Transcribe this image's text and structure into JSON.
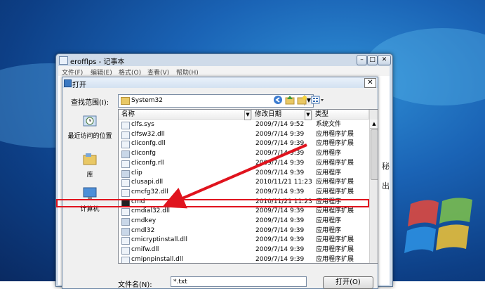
{
  "notepad": {
    "title": "erofflps - 记事本",
    "menu": [
      "文件(F)",
      "编辑(E)",
      "格式(O)",
      "查看(V)",
      "帮助(H)"
    ],
    "caption_buttons": [
      "–",
      "□",
      "✕"
    ],
    "edge_chars": [
      "秘",
      "出"
    ]
  },
  "dialog": {
    "title": "打开",
    "close_glyph": "✕",
    "lookin_label": "查找范围(I):",
    "lookin_value": "System32",
    "toolbar_icons": [
      "back-icon",
      "up-folder-icon",
      "new-folder-icon",
      "view-menu-icon"
    ],
    "places": [
      {
        "label": "最近访问的位置",
        "icon": "recent-places-icon"
      },
      {
        "label": "库",
        "icon": "libraries-icon"
      },
      {
        "label": "计算机",
        "icon": "computer-icon"
      }
    ],
    "columns": [
      "名称",
      "修改日期",
      "类型"
    ],
    "files": [
      {
        "name": "clfs.sys",
        "date": "2009/7/14 9:52",
        "type": "系统文件",
        "icon": "sys"
      },
      {
        "name": "clfsw32.dll",
        "date": "2009/7/14 9:39",
        "type": "应用程序扩展",
        "icon": "dll"
      },
      {
        "name": "cliconfg.dll",
        "date": "2009/7/14 9:39",
        "type": "应用程序扩展",
        "icon": "dll"
      },
      {
        "name": "cliconfg",
        "date": "2009/7/14 9:39",
        "type": "应用程序",
        "icon": "cpl"
      },
      {
        "name": "cliconfg.rll",
        "date": "2009/7/14 9:39",
        "type": "应用程序扩展",
        "icon": "dll"
      },
      {
        "name": "clip",
        "date": "2009/7/14 9:39",
        "type": "应用程序",
        "icon": "cpl"
      },
      {
        "name": "clusapi.dll",
        "date": "2010/11/21 11:23",
        "type": "应用程序扩展",
        "icon": "dll"
      },
      {
        "name": "cmcfg32.dll",
        "date": "2009/7/14 9:39",
        "type": "应用程序扩展",
        "icon": "dll"
      },
      {
        "name": "cmd",
        "date": "2010/11/21 11:23",
        "type": "应用程序",
        "icon": "exe"
      },
      {
        "name": "cmdial32.dll",
        "date": "2009/7/14 9:39",
        "type": "应用程序扩展",
        "icon": "dll"
      },
      {
        "name": "cmdkey",
        "date": "2009/7/14 9:39",
        "type": "应用程序",
        "icon": "cpl"
      },
      {
        "name": "cmdl32",
        "date": "2009/7/14 9:39",
        "type": "应用程序",
        "icon": "cpl"
      },
      {
        "name": "cmicryptinstall.dll",
        "date": "2009/7/14 9:39",
        "type": "应用程序扩展",
        "icon": "dll"
      },
      {
        "name": "cmifw.dll",
        "date": "2009/7/14 9:39",
        "type": "应用程序扩展",
        "icon": "dll"
      },
      {
        "name": "cmipnpinstall.dll",
        "date": "2009/7/14 9:39",
        "type": "应用程序扩展",
        "icon": "dll"
      }
    ],
    "highlighted_file": "cmd",
    "filename_label": "文件名(N):",
    "filename_value": "*.txt",
    "open_button": "打开(O)",
    "annotation_color": "#e0141e"
  }
}
